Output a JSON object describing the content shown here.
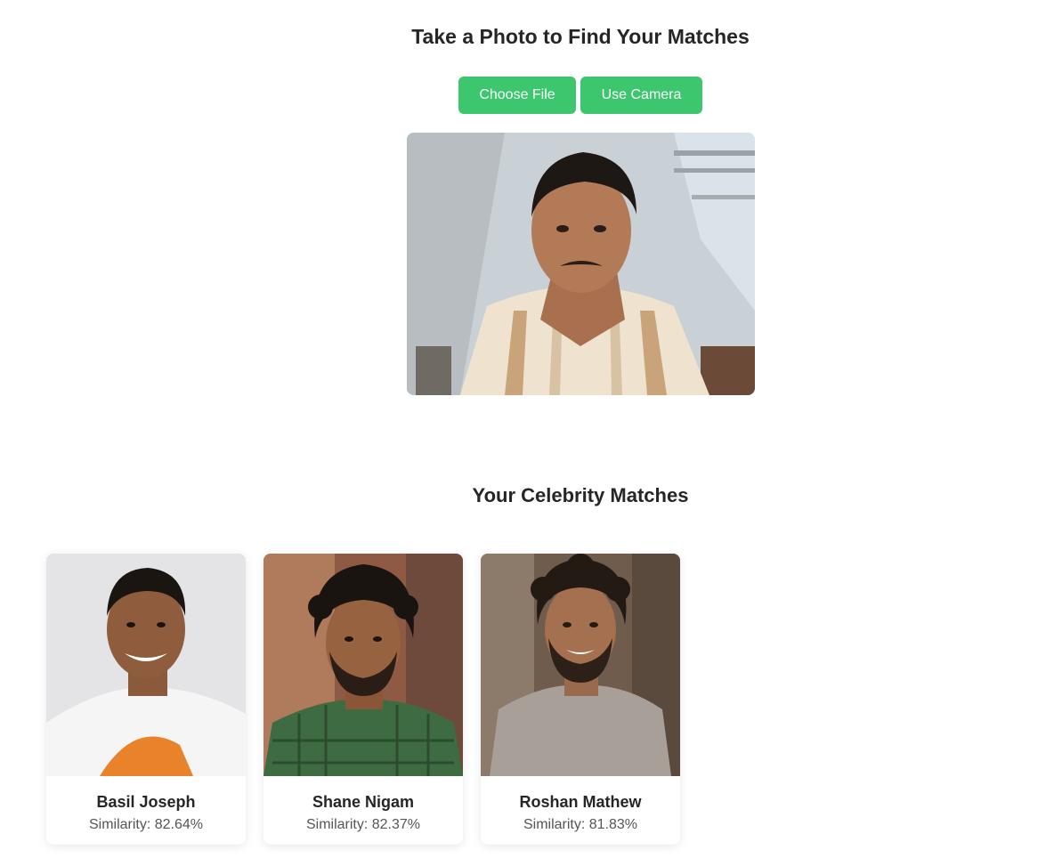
{
  "upload": {
    "title": "Take a Photo to Find Your Matches",
    "choose_file_label": "Choose File",
    "use_camera_label": "Use Camera"
  },
  "results": {
    "title": "Your Celebrity Matches",
    "matches": [
      {
        "name": "Basil Joseph",
        "similarity": "Similarity: 82.64%"
      },
      {
        "name": "Shane Nigam",
        "similarity": "Similarity: 82.37%"
      },
      {
        "name": "Roshan Mathew",
        "similarity": "Similarity: 81.83%"
      }
    ]
  },
  "colors": {
    "accent": "#3cc66e",
    "text": "#262626"
  }
}
